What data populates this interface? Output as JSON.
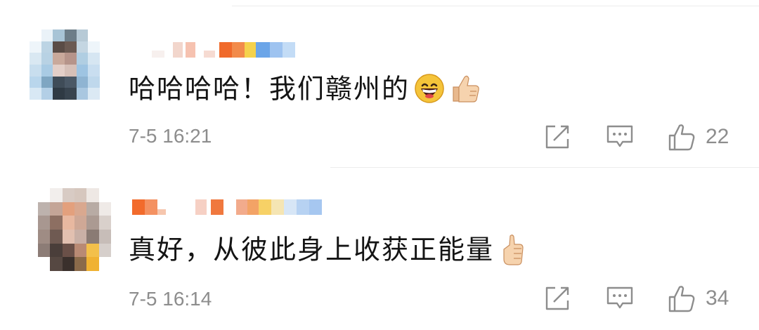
{
  "comments": [
    {
      "text": "哈哈哈哈！我们赣州的",
      "emojis": [
        "grinning-face",
        "thumbs-up"
      ],
      "timestamp": "7-5 16:21",
      "likes": "22",
      "name_blurred": true
    },
    {
      "text": "真好，从彼此身上收获正能量",
      "emojis": [
        "thumbs-up"
      ],
      "timestamp": "7-5 16:14",
      "likes": "34",
      "name_blurred": true
    }
  ],
  "colors": {
    "text": "#141414",
    "meta": "#8d8d8d",
    "divider": "#ececec"
  }
}
